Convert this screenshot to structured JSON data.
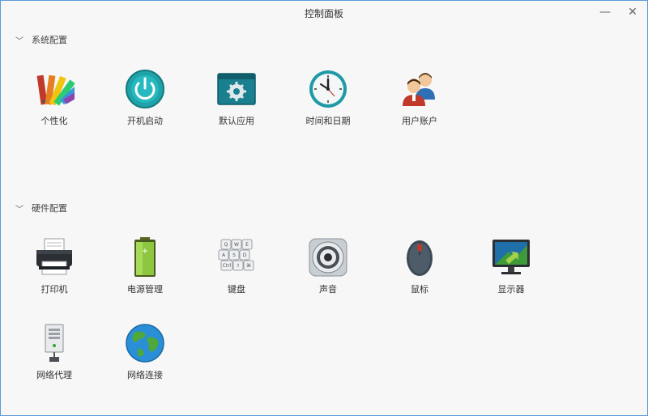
{
  "window": {
    "title": "控制面板",
    "minimize_glyph": "—",
    "close_glyph": "✕"
  },
  "sections": [
    {
      "title": "系统配置",
      "chevron": "﹀",
      "items": [
        {
          "label": "个性化",
          "icon": "personalization-icon"
        },
        {
          "label": "开机启动",
          "icon": "power-icon"
        },
        {
          "label": "默认应用",
          "icon": "default-apps-icon"
        },
        {
          "label": "时间和日期",
          "icon": "clock-icon"
        },
        {
          "label": "用户账户",
          "icon": "users-icon"
        }
      ]
    },
    {
      "title": "硬件配置",
      "chevron": "﹀",
      "items": [
        {
          "label": "打印机",
          "icon": "printer-icon"
        },
        {
          "label": "电源管理",
          "icon": "battery-icon"
        },
        {
          "label": "键盘",
          "icon": "keyboard-icon"
        },
        {
          "label": "声音",
          "icon": "speaker-icon"
        },
        {
          "label": "鼠标",
          "icon": "mouse-icon"
        },
        {
          "label": "显示器",
          "icon": "monitor-icon"
        },
        {
          "label": "网络代理",
          "icon": "proxy-server-icon"
        },
        {
          "label": "网络连接",
          "icon": "globe-icon"
        }
      ]
    }
  ]
}
